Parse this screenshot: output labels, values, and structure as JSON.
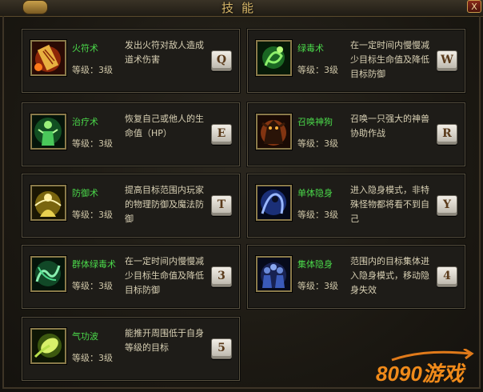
{
  "window": {
    "title": "技能",
    "close_label": "X"
  },
  "skills": [
    {
      "name": "火符术",
      "level": "等级：3级",
      "desc": "发出火符对敌人造成道术伤害",
      "key": "Q",
      "icon": "fire-talisman-icon"
    },
    {
      "name": "绿毒术",
      "level": "等级：3级",
      "desc": "在一定时间内慢慢减少目标生命值及降低目标防御",
      "key": "W",
      "icon": "green-poison-icon"
    },
    {
      "name": "治疗术",
      "level": "等级：3级",
      "desc": "恢复自己或他人的生命值（HP）",
      "key": "E",
      "icon": "healing-icon"
    },
    {
      "name": "召唤神狗",
      "level": "等级：3级",
      "desc": "召唤一只强大的神兽协助作战",
      "key": "R",
      "icon": "summon-beast-icon"
    },
    {
      "name": "防御术",
      "level": "等级：3级",
      "desc": "提高目标范围内玩家的物理防御及魔法防御",
      "key": "T",
      "icon": "defense-icon"
    },
    {
      "name": "单体隐身",
      "level": "等级：3级",
      "desc": "进入隐身模式，非特殊怪物都将看不到自己",
      "key": "Y",
      "icon": "stealth-icon"
    },
    {
      "name": "群体绿毒术",
      "level": "等级：3级",
      "desc": "在一定时间内慢慢减少目标生命值及降低目标防御",
      "key": "3",
      "icon": "mass-poison-icon"
    },
    {
      "name": "集体隐身",
      "level": "等级：3级",
      "desc": "范围内的目标集体进入隐身模式，移动隐身失效",
      "key": "4",
      "icon": "mass-stealth-icon"
    },
    {
      "name": "气功波",
      "level": "等级：3级",
      "desc": "能推开周围低于自身等级的目标",
      "key": "5",
      "icon": "qigong-wave-icon"
    }
  ],
  "watermark": {
    "text": "8090游戏"
  }
}
